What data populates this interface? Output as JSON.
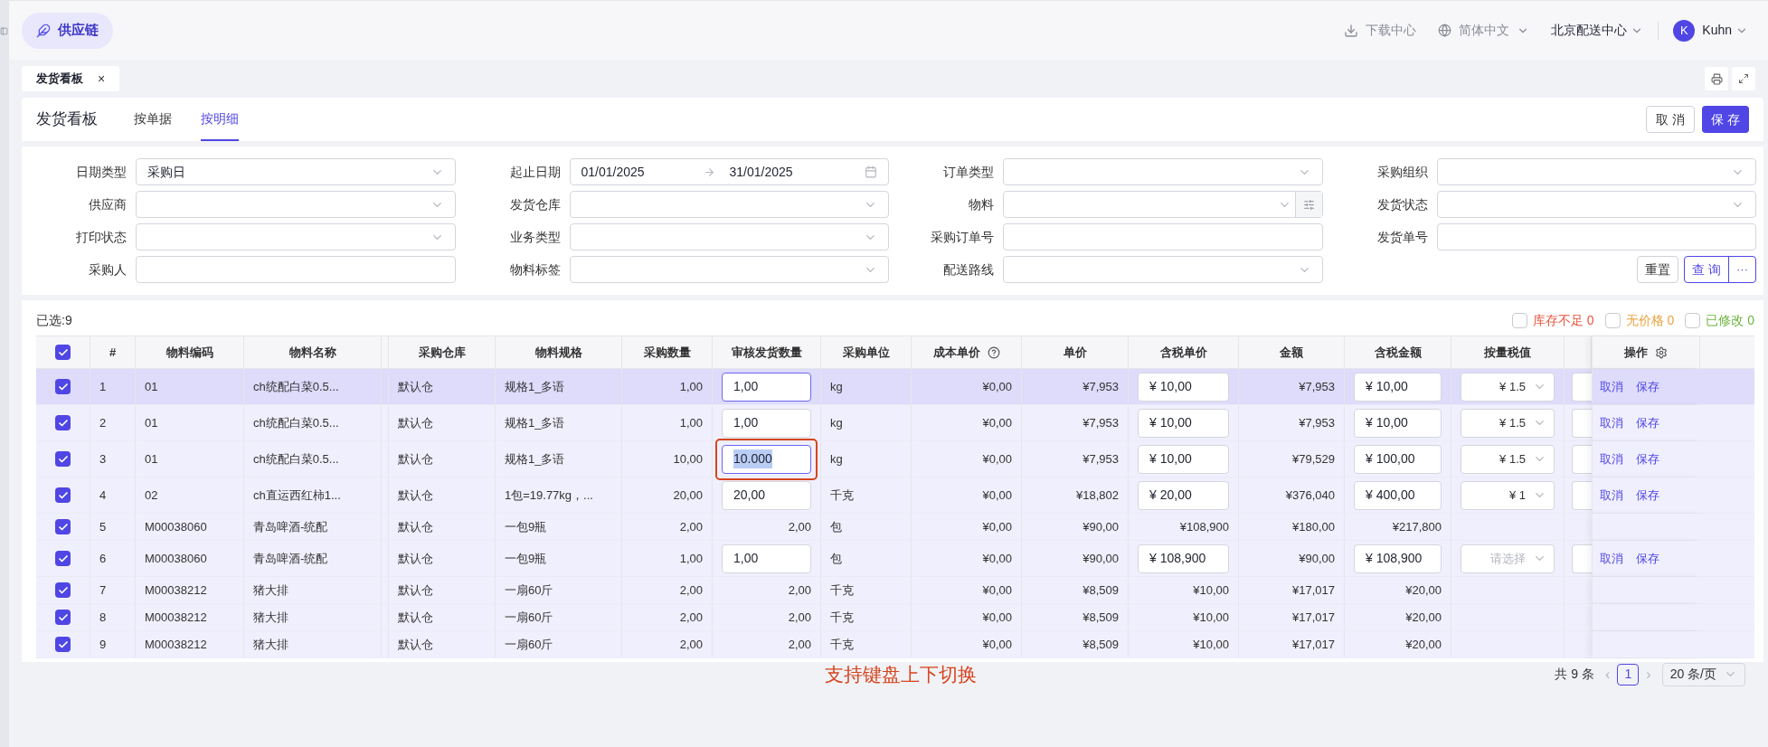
{
  "top_bar": {
    "logo": "供应链",
    "download": "下载中心",
    "language": "简体中文",
    "center": "北京配送中心",
    "avatar": "K",
    "user": "Kuhn"
  },
  "page_tab": {
    "label": "发货看板",
    "close": "×"
  },
  "header": {
    "title": "发货看板",
    "tabs": [
      {
        "label": "按单据",
        "selected": false
      },
      {
        "label": "按明细",
        "selected": true
      }
    ],
    "buttons": [
      {
        "label": "取 消",
        "kind": "default"
      },
      {
        "label": "保 存",
        "kind": "primary"
      }
    ]
  },
  "filters": [
    {
      "label": "日期类型",
      "kind": "select",
      "value": "采购日"
    },
    {
      "label": "起止日期",
      "kind": "date",
      "start": "01/01/2025",
      "end": "31/01/2025"
    },
    {
      "label": "订单类型",
      "kind": "select"
    },
    {
      "label": "采购组织",
      "kind": "select"
    },
    {
      "label": "供应商",
      "kind": "select"
    },
    {
      "label": "发货仓库",
      "kind": "select"
    },
    {
      "label": "物料",
      "kind": "picker"
    },
    {
      "label": "发货状态",
      "kind": "select"
    },
    {
      "label": "打印状态",
      "kind": "select"
    },
    {
      "label": "业务类型",
      "kind": "select"
    },
    {
      "label": "采购订单号",
      "kind": "input"
    },
    {
      "label": "发货单号",
      "kind": "input"
    },
    {
      "label": "采购人",
      "kind": "input"
    },
    {
      "label": "物料标签",
      "kind": "select"
    },
    {
      "label": "配送路线",
      "kind": "select"
    }
  ],
  "filter_buttons": {
    "reset": "重置",
    "query": "查 询",
    "more": "···"
  },
  "table": {
    "selected_count": "已选:9",
    "legend": [
      {
        "label": "库存不足",
        "count": "0",
        "color": "#e5533d",
        "checked": false
      },
      {
        "label": "无价格",
        "count": "0",
        "color": "#e8a13a",
        "checked": false
      },
      {
        "label": "已修改",
        "count": "0",
        "color": "#6cb33f",
        "checked": false
      }
    ],
    "header_checked": true,
    "columns": [
      "#",
      "物料编码",
      "物料名称",
      "采购仓库",
      "物料规格",
      "采购数量",
      "审核发货数量",
      "采购单位",
      "成本单价",
      "单价",
      "含税单价",
      "金额",
      "含税金额",
      "按量税值",
      "操作"
    ],
    "rows": [
      {
        "checked": true,
        "selected": true,
        "index": "1",
        "code": "01",
        "name": "ch统配白菜0.5...",
        "warehouse": "默认仓",
        "spec": "规格1_多语",
        "qty": "1,00",
        "review": {
          "kind": "input",
          "value": "1,00",
          "focused": false
        },
        "unit": "kg",
        "cost": "¥0,00",
        "price": "¥7,953",
        "tax_price": {
          "kind": "input",
          "value": "¥ 10,00"
        },
        "amount": "¥7,953",
        "tax_amount": {
          "kind": "input",
          "value": "¥ 10,00"
        },
        "tax_value": {
          "kind": "select",
          "value": "¥ 1.5"
        },
        "extra_input": true,
        "actions": [
          "取消",
          "保存"
        ]
      },
      {
        "checked": true,
        "selected": false,
        "index": "2",
        "code": "01",
        "name": "ch统配白菜0.5...",
        "warehouse": "默认仓",
        "spec": "规格1_多语",
        "qty": "1,00",
        "review": {
          "kind": "input",
          "value": "1,00",
          "focused": false
        },
        "unit": "kg",
        "cost": "¥0,00",
        "price": "¥7,953",
        "tax_price": {
          "kind": "input",
          "value": "¥ 10,00"
        },
        "amount": "¥7,953",
        "tax_amount": {
          "kind": "input",
          "value": "¥ 10,00"
        },
        "tax_value": {
          "kind": "select",
          "value": "¥ 1.5"
        },
        "extra_input": true,
        "actions": [
          "取消",
          "保存"
        ]
      },
      {
        "checked": true,
        "selected": false,
        "index": "3",
        "code": "01",
        "name": "ch统配白菜0.5...",
        "warehouse": "默认仓",
        "spec": "规格1_多语",
        "qty": "10,00",
        "review": {
          "kind": "input",
          "value": "10.000",
          "focused": true
        },
        "unit": "kg",
        "cost": "¥0,00",
        "price": "¥7,953",
        "tax_price": {
          "kind": "input",
          "value": "¥ 10,00"
        },
        "amount": "¥79,529",
        "tax_amount": {
          "kind": "input",
          "value": "¥ 100,00"
        },
        "tax_value": {
          "kind": "select",
          "value": "¥ 1.5"
        },
        "extra_input": true,
        "actions": [
          "取消",
          "保存"
        ]
      },
      {
        "checked": true,
        "selected": false,
        "index": "4",
        "code": "02",
        "name": "ch直运西红柿1...",
        "warehouse": "默认仓",
        "spec": "1包=19.77kg，...",
        "qty": "20,00",
        "review": {
          "kind": "input",
          "value": "20,00",
          "focused": false
        },
        "unit": "千克",
        "cost": "¥0,00",
        "price": "¥18,802",
        "tax_price": {
          "kind": "input",
          "value": "¥ 20,00"
        },
        "amount": "¥376,040",
        "tax_amount": {
          "kind": "input",
          "value": "¥ 400,00"
        },
        "tax_value": {
          "kind": "select",
          "value": "¥ 1"
        },
        "extra_input": true,
        "actions": [
          "取消",
          "保存"
        ]
      },
      {
        "checked": true,
        "selected": false,
        "index": "5",
        "code": "M00038060",
        "name": "青岛啤酒-统配",
        "warehouse": "默认仓",
        "spec": "一包9瓶",
        "qty": "2,00",
        "review": {
          "kind": "text",
          "value": "2,00"
        },
        "unit": "包",
        "cost": "¥0,00",
        "price": "¥90,00",
        "tax_price": {
          "kind": "text",
          "value": "¥108,900"
        },
        "amount": "¥180,00",
        "tax_amount": {
          "kind": "text",
          "value": "¥217,800"
        },
        "tax_value": {
          "kind": "none"
        },
        "extra_input": false,
        "actions": []
      },
      {
        "checked": true,
        "selected": false,
        "index": "6",
        "code": "M00038060",
        "name": "青岛啤酒-统配",
        "warehouse": "默认仓",
        "spec": "一包9瓶",
        "qty": "1,00",
        "review": {
          "kind": "input",
          "value": "1,00",
          "focused": false
        },
        "unit": "包",
        "cost": "¥0,00",
        "price": "¥90,00",
        "tax_price": {
          "kind": "input",
          "value": "¥ 108,900"
        },
        "amount": "¥90,00",
        "tax_amount": {
          "kind": "input",
          "value": "¥ 108,900"
        },
        "tax_value": {
          "kind": "select",
          "placeholder": "请选择"
        },
        "extra_input": true,
        "actions": [
          "取消",
          "保存"
        ]
      },
      {
        "checked": true,
        "selected": false,
        "index": "7",
        "code": "M00038212",
        "name": "猪大排",
        "warehouse": "默认仓",
        "spec": "一扇60斤",
        "qty": "2,00",
        "review": {
          "kind": "text",
          "value": "2,00"
        },
        "unit": "千克",
        "cost": "¥0,00",
        "price": "¥8,509",
        "tax_price": {
          "kind": "text",
          "value": "¥10,00"
        },
        "amount": "¥17,017",
        "tax_amount": {
          "kind": "text",
          "value": "¥20,00"
        },
        "tax_value": {
          "kind": "none"
        },
        "extra_input": false,
        "actions": []
      },
      {
        "checked": true,
        "selected": false,
        "index": "8",
        "code": "M00038212",
        "name": "猪大排",
        "warehouse": "默认仓",
        "spec": "一扇60斤",
        "qty": "2,00",
        "review": {
          "kind": "text",
          "value": "2,00"
        },
        "unit": "千克",
        "cost": "¥0,00",
        "price": "¥8,509",
        "tax_price": {
          "kind": "text",
          "value": "¥10,00"
        },
        "amount": "¥17,017",
        "tax_amount": {
          "kind": "text",
          "value": "¥20,00"
        },
        "tax_value": {
          "kind": "none"
        },
        "extra_input": false,
        "actions": []
      },
      {
        "checked": true,
        "selected": false,
        "index": "9",
        "code": "M00038212",
        "name": "猪大排",
        "warehouse": "默认仓",
        "spec": "一扇60斤",
        "qty": "2,00",
        "review": {
          "kind": "text",
          "value": "2,00"
        },
        "unit": "千克",
        "cost": "¥0,00",
        "price": "¥8,509",
        "tax_price": {
          "kind": "text",
          "value": "¥10,00"
        },
        "amount": "¥17,017",
        "tax_amount": {
          "kind": "text",
          "value": "¥20,00"
        },
        "tax_value": {
          "kind": "none"
        },
        "extra_input": false,
        "actions": []
      }
    ]
  },
  "annotation": "支持键盘上下切换",
  "pagination": {
    "total": "共 9 条",
    "prev": "‹",
    "pages": [
      {
        "label": "1",
        "selected": true
      }
    ],
    "next": "›",
    "page_size": "20 条/页"
  }
}
